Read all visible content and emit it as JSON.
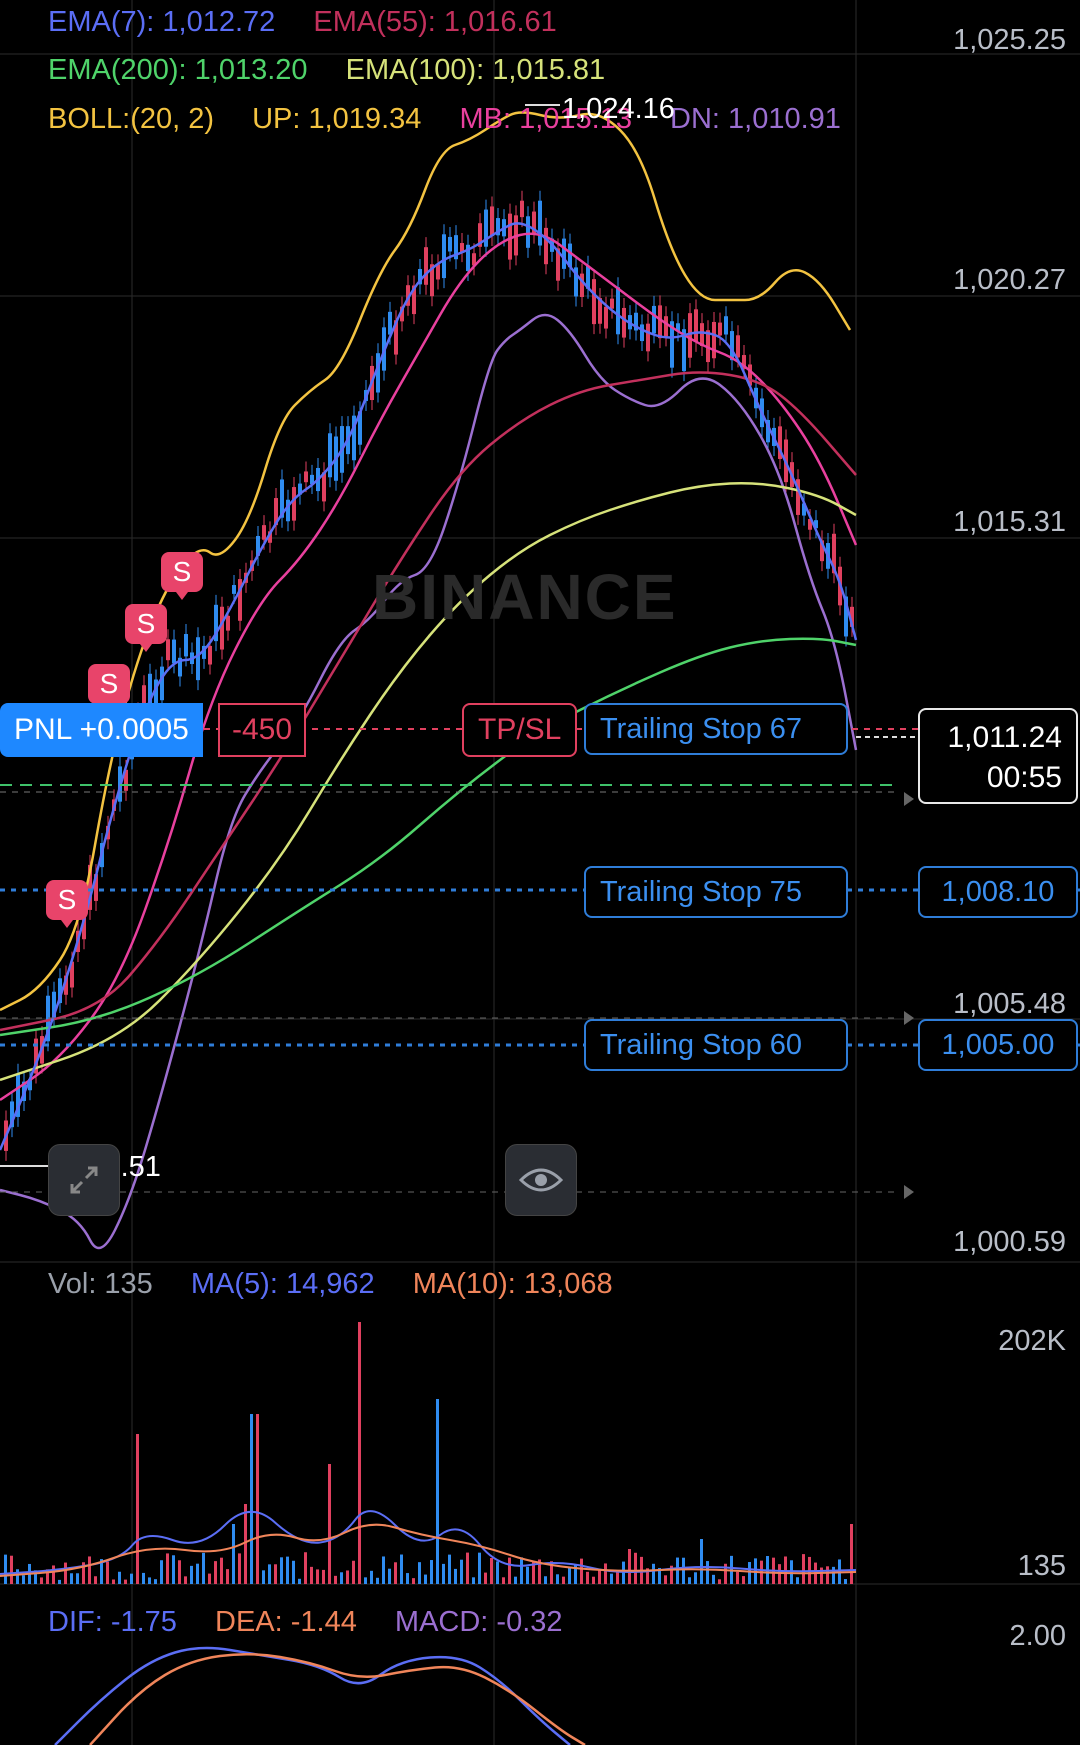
{
  "legend": {
    "ema7": "EMA(7): 1,012.72",
    "ema55": "EMA(55): 1,016.61",
    "ema200": "EMA(200): 1,013.20",
    "ema100": "EMA(100): 1,015.81",
    "boll": "BOLL:(20, 2)",
    "up": "UP: 1,019.34",
    "mb": "MB: 1,015.13",
    "dn": "DN: 1,010.91"
  },
  "price_axis": [
    "1,025.25",
    "1,020.27",
    "1,015.31",
    "1,005.48",
    "1,000.59"
  ],
  "high_label": "1,024.16",
  "low_label": "1,002.51",
  "watermark": "BINANCE",
  "position": {
    "pnl": "PNL +0.0005",
    "qty": "-450",
    "tpsl": "TP/SL"
  },
  "current_price": {
    "price": "1,011.24",
    "countdown": "00:55"
  },
  "trailing_stops": [
    {
      "label": "Trailing Stop  67",
      "price": ""
    },
    {
      "label": "Trailing Stop  75",
      "price": "1,008.10"
    },
    {
      "label": "Trailing Stop  60",
      "price": "1,005.00"
    }
  ],
  "sell_marker": "S",
  "volume": {
    "vol": "Vol: 135",
    "ma5": "MA(5): 14,962",
    "ma10": "MA(10): 13,068",
    "axis_top": "202K",
    "axis_bottom": "135"
  },
  "macd": {
    "dif": "DIF: -1.75",
    "dea": "DEA: -1.44",
    "macd": "MACD: -0.32",
    "axis_top": "2.00"
  },
  "colors": {
    "ema7": "#5b6ef5",
    "ema55": "#c2305c",
    "ema200": "#4fd36a",
    "ema100": "#d6e27a",
    "boll": "#f3c341",
    "mb": "#e9409e",
    "dn": "#9b6fd0",
    "up_candle": "#2f8cf0",
    "down_candle": "#e0405f",
    "trailing": "#2f7dd8"
  },
  "chart_data": [
    {
      "type": "line",
      "title": "",
      "ylabel": "",
      "ylim": [
        999.5,
        1026
      ],
      "x": [
        0,
        4,
        8,
        12,
        16,
        20,
        24,
        28,
        32,
        36,
        40,
        44,
        48,
        52,
        56,
        60,
        64,
        68,
        72,
        76,
        80,
        84,
        86
      ],
      "series": [
        {
          "name": "BOLL UP",
          "values": [
            1005.8,
            1008.2,
            1012.0,
            1014.8,
            1015.4,
            1016.4,
            1018.3,
            1021.0,
            1024.2,
            1025.0,
            1024.6,
            1023.6,
            1021.7,
            1020.9,
            1021.2,
            1020.7,
            1020.0,
            1019.3
          ]
        },
        {
          "name": "EMA(7)",
          "values": [
            1002.0,
            1006.0,
            1010.8,
            1013.3,
            1014.0,
            1015.5,
            1017.0,
            1019.0,
            1021.0,
            1022.8,
            1022.4,
            1021.0,
            1020.2,
            1019.7,
            1020.2,
            1018.5,
            1015.5,
            1012.7
          ]
        }
      ]
    },
    {
      "type": "bar",
      "title": "",
      "series": [
        {
          "name": "Vol",
          "values": [
            135
          ]
        }
      ]
    }
  ]
}
